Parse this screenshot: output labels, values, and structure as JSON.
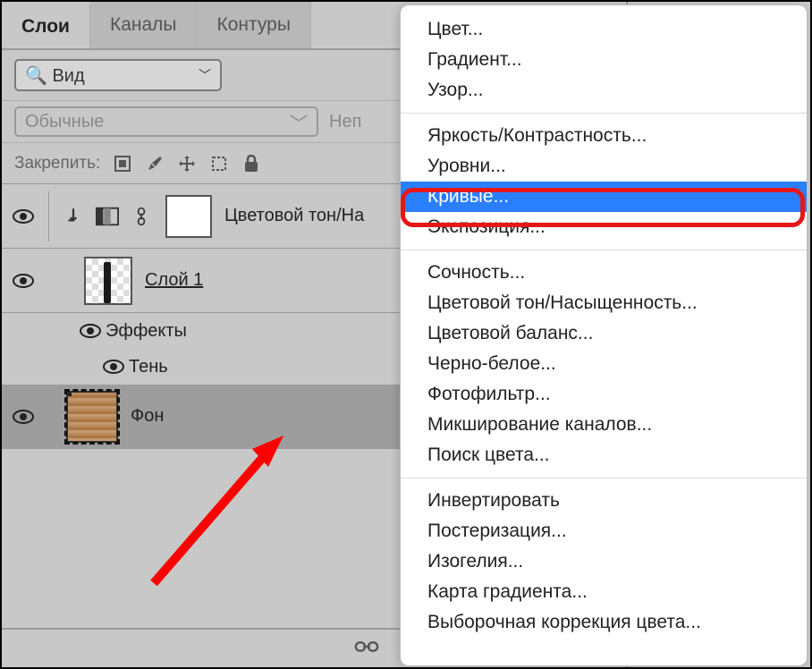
{
  "tabs": {
    "layers": "Слои",
    "channels": "Каналы",
    "paths": "Контуры"
  },
  "toolbar": {
    "view_label": "Вид",
    "blend_mode": "Обычные",
    "opacity_label": "Неп",
    "lock_label": "Закрепить:"
  },
  "layers": {
    "adj_name": "Цветовой тон/На",
    "layer1_name": "Слой 1",
    "effects_label": "Эффекты",
    "shadow_label": "Тень",
    "bg_name": "Фон"
  },
  "menu": {
    "group1": [
      "Цвет...",
      "Градиент...",
      "Узор..."
    ],
    "group2": [
      "Яркость/Контрастность...",
      "Уровни...",
      "Кривые...",
      "Экспозиция..."
    ],
    "group3": [
      "Сочность...",
      "Цветовой тон/Насыщенность...",
      "Цветовой баланс...",
      "Черно-белое...",
      "Фотофильтр...",
      "Микширование каналов...",
      "Поиск цвета..."
    ],
    "group4": [
      "Инвертировать",
      "Постеризация...",
      "Изогелия...",
      "Карта градиента...",
      "Выборочная коррекция цвета..."
    ],
    "selected": "Кривые..."
  }
}
